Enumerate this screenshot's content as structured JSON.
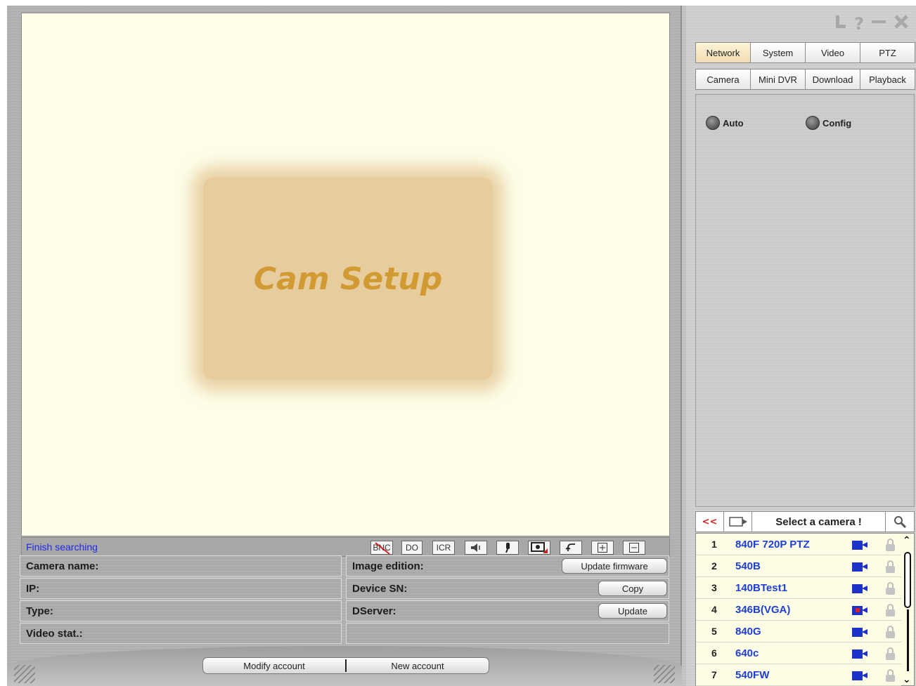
{
  "video": {
    "logo_text": "Cam Setup"
  },
  "status": {
    "text": "Finish searching"
  },
  "toolbar": {
    "bnc": "BNC",
    "do": "DO",
    "icr": "ICR"
  },
  "info": {
    "camera_name_label": "Camera name:",
    "ip_label": "IP:",
    "type_label": "Type:",
    "video_stat_label": "Video stat.:",
    "image_edition_label": "Image edition:",
    "device_sn_label": "Device SN:",
    "dserver_label": "DServer:",
    "update_firmware_btn": "Update firmware",
    "copy_btn": "Copy",
    "update_btn": "Update"
  },
  "account": {
    "modify": "Modify account",
    "new": "New account"
  },
  "tabs": {
    "row1": [
      "Network",
      "System",
      "Video",
      "PTZ"
    ],
    "row2": [
      "Camera",
      "Mini DVR",
      "Download",
      "Playback"
    ]
  },
  "network": {
    "auto_label": "Auto",
    "config_label": "Config"
  },
  "camera_list": {
    "back_label": "<<",
    "select_label": "Select a camera",
    "select_mark": "!",
    "items": [
      {
        "num": "1",
        "name": "840F 720P PTZ",
        "recording": false
      },
      {
        "num": "2",
        "name": "540B",
        "recording": false
      },
      {
        "num": "3",
        "name": "140BTest1",
        "recording": false
      },
      {
        "num": "4",
        "name": "346B(VGA)",
        "recording": true
      },
      {
        "num": "5",
        "name": "840G",
        "recording": false
      },
      {
        "num": "6",
        "name": "640c",
        "recording": false
      },
      {
        "num": "7",
        "name": "540FW",
        "recording": false
      }
    ]
  },
  "icons": {
    "window": [
      "login-icon",
      "help-icon",
      "minimize-icon",
      "close-icon"
    ],
    "camera_color": "#1c32c8",
    "status_color": "#1f28e6"
  }
}
